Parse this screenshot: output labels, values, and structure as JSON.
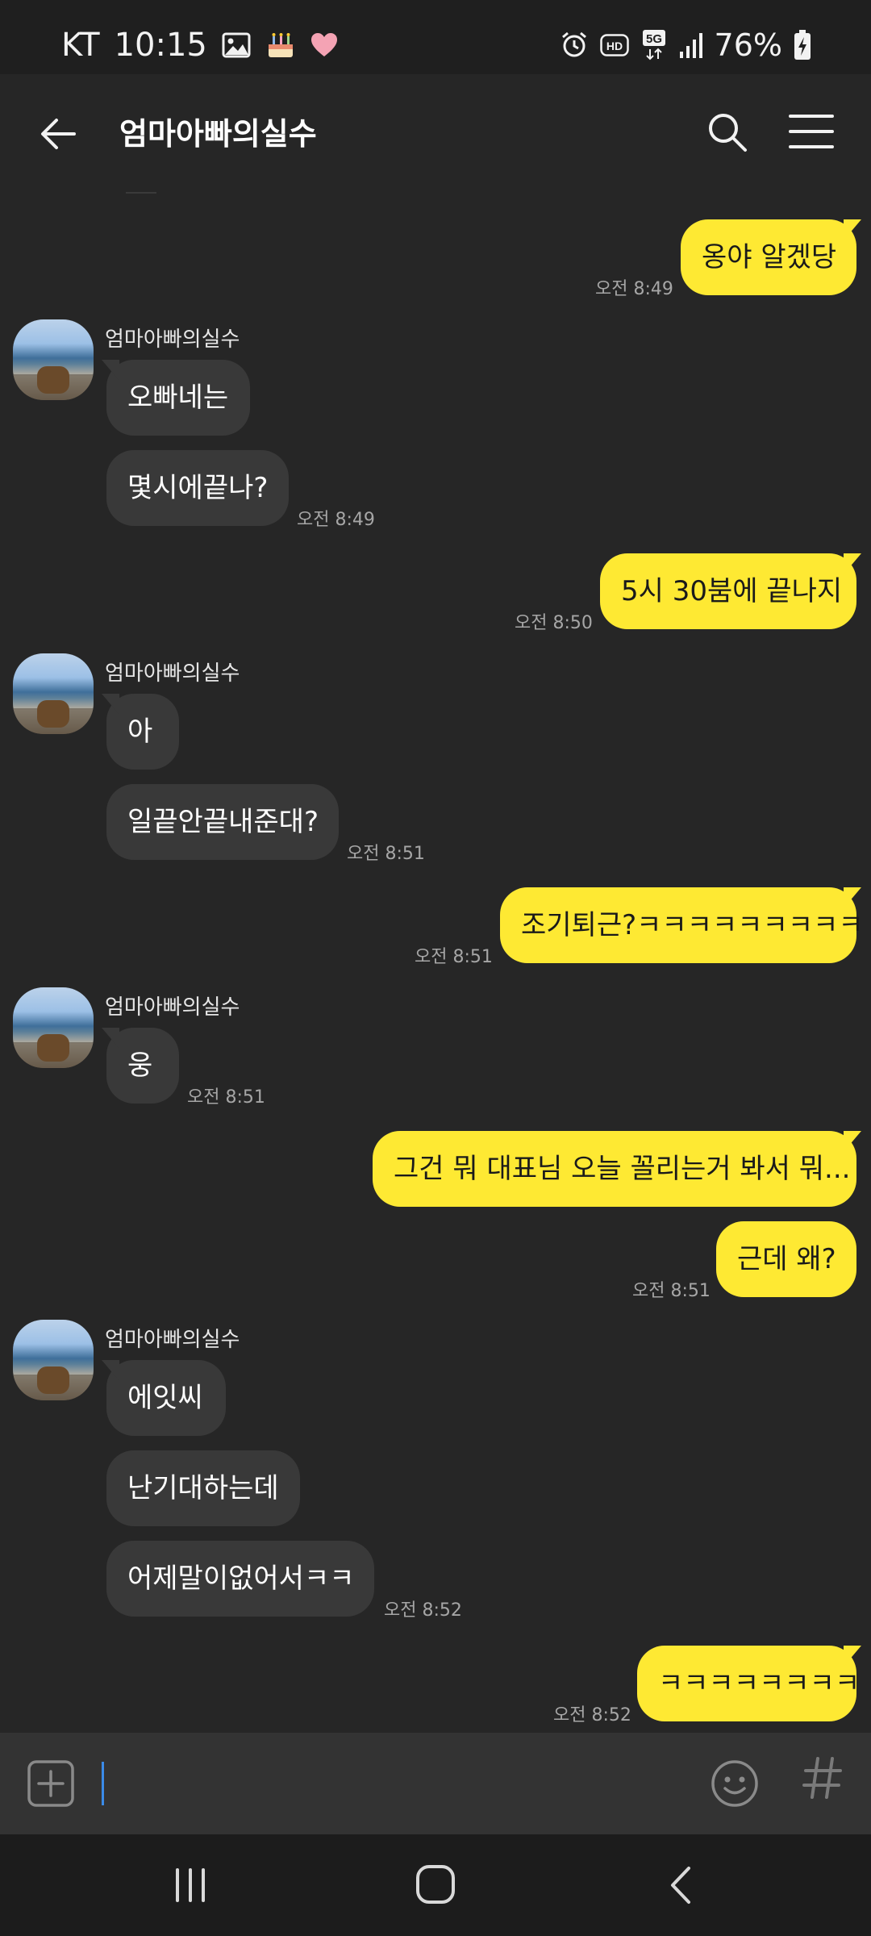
{
  "status_bar": {
    "carrier": "KT",
    "time": "10:15",
    "network": "5G",
    "battery": "76%",
    "icons": [
      "image-icon",
      "cake-icon",
      "heart-icon",
      "alarm-icon",
      "hd-icon",
      "5g-icon",
      "signal-icon",
      "battery-charging-icon"
    ]
  },
  "header": {
    "title": "엄마아빠의실수"
  },
  "messages": [
    {
      "from": "me",
      "text": "옹야 알겠당",
      "time": "오전 8:49"
    },
    {
      "from": "other",
      "sender": "엄마아빠의실수",
      "text": "오빠네는"
    },
    {
      "from": "other",
      "text": "몇시에끝나?",
      "time": "오전 8:49"
    },
    {
      "from": "me",
      "text": "5시 30붐에 끝나지",
      "time": "오전 8:50"
    },
    {
      "from": "other",
      "sender": "엄마아빠의실수",
      "text": "아"
    },
    {
      "from": "other",
      "text": "일끝안끝내준대?",
      "time": "오전 8:51"
    },
    {
      "from": "me",
      "text": "조기퇴근?ㅋㅋㅋㅋㅋㅋㅋㅋㅋ",
      "time": "오전 8:51"
    },
    {
      "from": "other",
      "sender": "엄마아빠의실수",
      "text": "웅",
      "time": "오전 8:51"
    },
    {
      "from": "me",
      "text": "그건 뭐 대표님 오늘 꼴리는거 봐서 뭐..."
    },
    {
      "from": "me",
      "text": "근데 왜?",
      "time": "오전 8:51"
    },
    {
      "from": "other",
      "sender": "엄마아빠의실수",
      "text": "에잇씨"
    },
    {
      "from": "other",
      "text": "난기대하는데"
    },
    {
      "from": "other",
      "text": "어제말이없어서ㅋㅋ",
      "time": "오전 8:52"
    },
    {
      "from": "me",
      "text": "ㅋㅋㅋㅋㅋㅋㅋㅋ",
      "time": "오전 8:52"
    }
  ],
  "input": {
    "placeholder": "",
    "value": ""
  },
  "colors": {
    "my_bubble": "#fee933",
    "other_bubble": "#393939",
    "background": "#262626",
    "caret": "#3b8be8"
  }
}
